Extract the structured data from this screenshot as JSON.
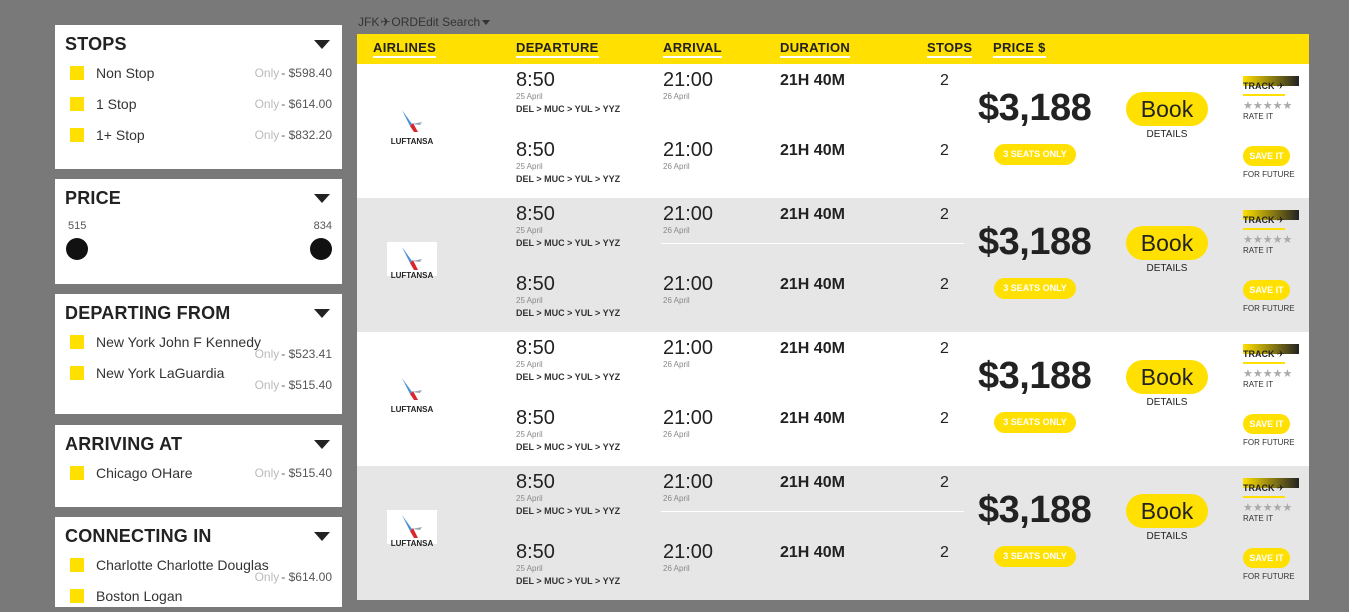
{
  "filters": {
    "stops": {
      "title": "STOPS",
      "options": [
        {
          "label": "Non Stop",
          "only": "Only",
          "price": "- $598.40"
        },
        {
          "label": "1 Stop",
          "only": "Only",
          "price": "- $614.00"
        },
        {
          "label": "1+ Stop",
          "only": "Only",
          "price": "- $832.20"
        }
      ]
    },
    "price": {
      "title": "PRICE",
      "min": "515",
      "max": "834"
    },
    "departing": {
      "title": "DEPARTING FROM",
      "options": [
        {
          "label": "New York John F Kennedy",
          "only": "Only",
          "price": "- $523.41"
        },
        {
          "label": "New York LaGuardia",
          "only": "Only",
          "price": "- $515.40"
        }
      ]
    },
    "arriving": {
      "title": "ARRIVING AT",
      "options": [
        {
          "label": "Chicago OHare",
          "only": "Only",
          "price": "- $515.40"
        }
      ]
    },
    "connecting": {
      "title": "CONNECTING IN",
      "options": [
        {
          "label": "Charlotte Charlotte Douglas",
          "only": "Only",
          "price": "- $614.00"
        },
        {
          "label": "Boston Logan"
        }
      ]
    }
  },
  "header": {
    "from": "JFK",
    "to": "ORD",
    "edit": "Edit Search",
    "columns": {
      "airlines": "AIRLINES",
      "departure": "DEPARTURE",
      "arrival": "ARRIVAL",
      "duration": "DURATION",
      "stops": "STOPS",
      "price": "PRICE $"
    }
  },
  "results": [
    {
      "airline": "LUFTANSA",
      "segments": [
        {
          "dep_time": "8:50",
          "dep_date": "25 April",
          "route": "DEL > MUC > YUL > YYZ",
          "arr_time": "21:00",
          "arr_date": "26 April",
          "duration": "21H 40M",
          "stops": "2"
        },
        {
          "dep_time": "8:50",
          "dep_date": "25 April",
          "route": "DEL > MUC > YUL > YYZ",
          "arr_time": "21:00",
          "arr_date": "26 April",
          "duration": "21H 40M",
          "stops": "2"
        }
      ],
      "price": "$3,188",
      "seats": "3 SEATS ONLY",
      "book": "Book",
      "details": "DETAILS",
      "track": "TRACK",
      "rate": "RATE IT",
      "save": "SAVE IT",
      "future": "FOR FUTURE",
      "stars": "★★★★★"
    },
    {
      "airline": "LUFTANSA",
      "segments": [
        {
          "dep_time": "8:50",
          "dep_date": "25 April",
          "route": "DEL > MUC > YUL > YYZ",
          "arr_time": "21:00",
          "arr_date": "26 April",
          "duration": "21H 40M",
          "stops": "2"
        },
        {
          "dep_time": "8:50",
          "dep_date": "25 April",
          "route": "DEL > MUC > YUL > YYZ",
          "arr_time": "21:00",
          "arr_date": "26 April",
          "duration": "21H 40M",
          "stops": "2"
        }
      ],
      "price": "$3,188",
      "seats": "3 SEATS ONLY",
      "book": "Book",
      "details": "DETAILS",
      "track": "TRACK",
      "rate": "RATE IT",
      "save": "SAVE IT",
      "future": "FOR FUTURE",
      "stars": "★★★★★"
    },
    {
      "airline": "LUFTANSA",
      "segments": [
        {
          "dep_time": "8:50",
          "dep_date": "25 April",
          "route": "DEL > MUC > YUL > YYZ",
          "arr_time": "21:00",
          "arr_date": "26 April",
          "duration": "21H 40M",
          "stops": "2"
        },
        {
          "dep_time": "8:50",
          "dep_date": "25 April",
          "route": "DEL > MUC > YUL > YYZ",
          "arr_time": "21:00",
          "arr_date": "26 April",
          "duration": "21H 40M",
          "stops": "2"
        }
      ],
      "price": "$3,188",
      "seats": "3 SEATS ONLY",
      "book": "Book",
      "details": "DETAILS",
      "track": "TRACK",
      "rate": "RATE IT",
      "save": "SAVE IT",
      "future": "FOR FUTURE",
      "stars": "★★★★★"
    },
    {
      "airline": "LUFTANSA",
      "segments": [
        {
          "dep_time": "8:50",
          "dep_date": "25 April",
          "route": "DEL > MUC > YUL > YYZ",
          "arr_time": "21:00",
          "arr_date": "26 April",
          "duration": "21H 40M",
          "stops": "2"
        },
        {
          "dep_time": "8:50",
          "dep_date": "25 April",
          "route": "DEL > MUC > YUL > YYZ",
          "arr_time": "21:00",
          "arr_date": "26 April",
          "duration": "21H 40M",
          "stops": "2"
        }
      ],
      "price": "$3,188",
      "seats": "3 SEATS ONLY",
      "book": "Book",
      "details": "DETAILS",
      "track": "TRACK",
      "rate": "RATE IT",
      "save": "SAVE IT",
      "future": "FOR FUTURE",
      "stars": "★★★★★"
    }
  ],
  "colors": {
    "accent": "#ffe000",
    "background": "#7a797a",
    "alt_row": "#e6e6e6"
  }
}
